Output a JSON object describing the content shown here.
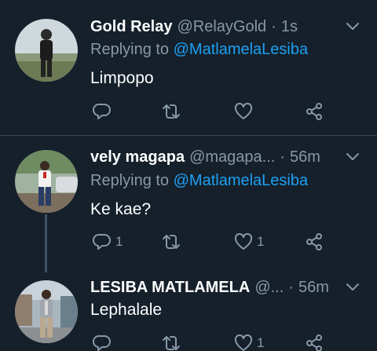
{
  "tweets": [
    {
      "name": "Gold Relay",
      "handle": "@RelayGold",
      "separator": "·",
      "time": "1s",
      "replying_prefix": "Replying to ",
      "replying_to": "@MatlamelaLesiba",
      "text": "Limpopo",
      "reply_count": "",
      "retweet_count": "",
      "like_count": ""
    },
    {
      "name": "vely magapa",
      "handle": "@magapa...",
      "separator": "·",
      "time": "56m",
      "replying_prefix": "Replying to ",
      "replying_to": "@MatlamelaLesiba",
      "text": "Ke kae?",
      "reply_count": "1",
      "retweet_count": "",
      "like_count": "1"
    },
    {
      "name": "LESIBA MATLAMELA",
      "handle": "@...",
      "separator": "·",
      "time": "56m",
      "text": "Lephalale",
      "reply_count": "",
      "retweet_count": "",
      "like_count": "1"
    }
  ],
  "icons": {
    "reply": "reply-icon",
    "retweet": "retweet-icon",
    "like": "heart-icon",
    "share": "share-icon",
    "more": "chevron-down-icon"
  },
  "colors": {
    "background": "#15202b",
    "secondary_text": "#8899a6",
    "mention": "#1da1f2",
    "divider": "#38444d"
  }
}
